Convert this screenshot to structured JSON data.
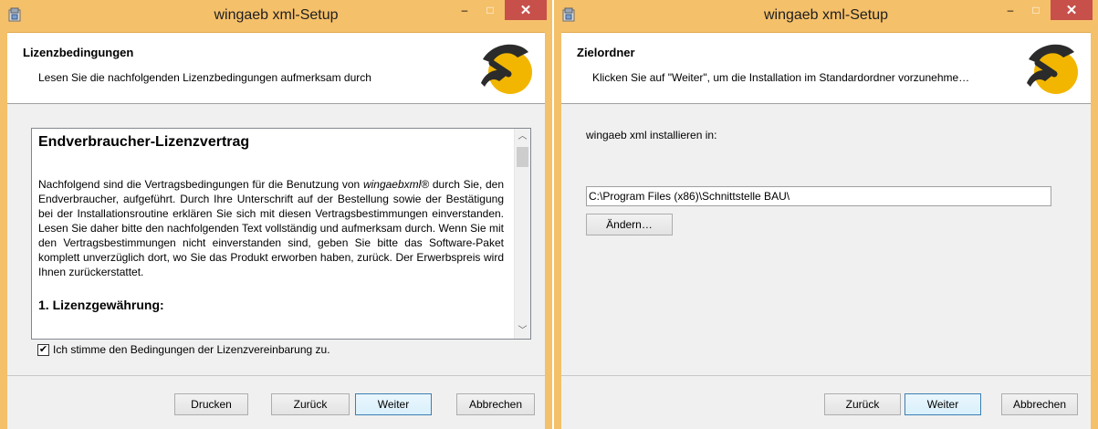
{
  "left": {
    "title": "wingaeb xml-Setup",
    "header_title": "Lizenzbedingungen",
    "header_subtitle": "Lesen Sie die nachfolgenden Lizenzbedingungen aufmerksam durch",
    "license_heading": "Endverbraucher-Lizenzvertrag",
    "license_para_prefix": "Nachfolgend sind die Vertragsbedingungen für die Benutzung von ",
    "license_para_product": "wingaebxml®",
    "license_para_rest": " durch Sie, den Endverbraucher, aufgeführt. Durch Ihre Unterschrift auf der Bestellung sowie der Bestätigung bei der Installationsroutine erklären Sie sich mit diesen Vertragsbestimmungen einverstanden. Lesen Sie daher bitte den nachfolgenden Text vollständig und aufmerksam durch. Wenn Sie mit den Vertragsbestimmungen nicht einverstanden sind, geben Sie bitte das Software-Paket komplett unverzüglich dort, wo Sie das Produkt erworben haben, zurück. Der Erwerbspreis wird Ihnen zurückerstattet.",
    "license_section": "1. Lizenzgewährung:",
    "checkbox_label": "Ich stimme den Bedingungen der Lizenzvereinbarung zu.",
    "checkbox_checked": true,
    "buttons": {
      "print": "Drucken",
      "back": "Zurück",
      "next": "Weiter",
      "cancel": "Abbrechen"
    }
  },
  "right": {
    "title": "wingaeb xml-Setup",
    "header_title": "Zielordner",
    "header_subtitle": "Klicken Sie auf \"Weiter\", um die Installation im Standardordner vorzunehme…",
    "install_label": "wingaeb xml installieren in:",
    "install_path": "C:\\Program Files (x86)\\Schnittstelle BAU\\",
    "change_button": "Ändern…",
    "buttons": {
      "back": "Zurück",
      "next": "Weiter",
      "cancel": "Abbrechen"
    }
  },
  "window_controls": {
    "minimize": "–",
    "maximize": "□",
    "close": "✕"
  },
  "colors": {
    "titlebar": "#f5c06a",
    "close_button": "#c7504a",
    "logo_yellow": "#f2b600",
    "logo_dark": "#2b2b2b"
  }
}
